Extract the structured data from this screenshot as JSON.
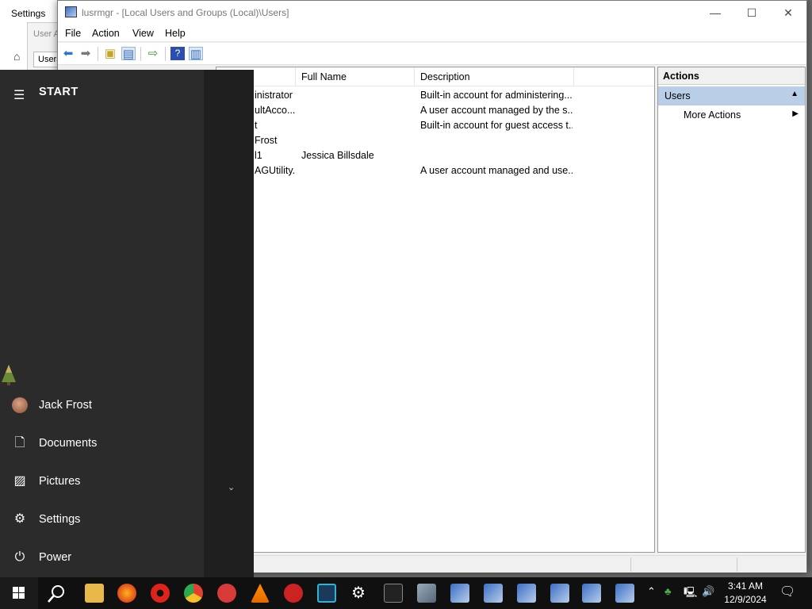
{
  "settings_window": {
    "title": "Settings",
    "sub_title": "User A",
    "tab": "Users"
  },
  "mmc": {
    "title": "lusrmgr - [Local Users and Groups (Local)\\Users]",
    "window_buttons": {
      "minimize": "—",
      "maximize": "☐",
      "close": "✕"
    },
    "menu": [
      "File",
      "Action",
      "View",
      "Help"
    ],
    "columns": {
      "name": "",
      "full_name": "Full Name",
      "description": "Description"
    },
    "rows": [
      {
        "name": "inistrator",
        "full_name": "",
        "description": "Built-in account for administering..."
      },
      {
        "name": "ultAcco...",
        "full_name": "",
        "description": "A user account managed by the s..."
      },
      {
        "name": "t",
        "full_name": "",
        "description": "Built-in account for guest access t..."
      },
      {
        "name": "Frost",
        "full_name": "",
        "description": ""
      },
      {
        "name": "l1",
        "full_name": "Jessica Billsdale",
        "description": ""
      },
      {
        "name": "AGUtility...",
        "full_name": "",
        "description": "A user account managed and use..."
      }
    ],
    "actions": {
      "header": "Actions",
      "section": "Users",
      "more": "More Actions"
    }
  },
  "start_menu": {
    "header": "START",
    "user": "Jack Frost",
    "items": [
      {
        "label": "Documents",
        "icon": "document-icon"
      },
      {
        "label": "Pictures",
        "icon": "picture-icon"
      },
      {
        "label": "Settings",
        "icon": "gear-icon"
      },
      {
        "label": "Power",
        "icon": "power-icon"
      }
    ]
  },
  "taskbar": {
    "apps": [
      "search",
      "file-explorer",
      "firefox",
      "radiation-app",
      "chrome",
      "angry-birds",
      "vlc",
      "red-app",
      "virtualbox",
      "settings",
      "terminal",
      "user-manager",
      "lusrmgr-1",
      "lusrmgr-2",
      "lusrmgr-3",
      "lusrmgr-4",
      "lusrmgr-5",
      "lusrmgr-6"
    ],
    "time": "3:41 AM",
    "date": "12/9/2024"
  },
  "colors": {
    "start_bg": "#2b2b2b",
    "taskbar_bg": "#101010",
    "selection": "#b8cfe7"
  }
}
